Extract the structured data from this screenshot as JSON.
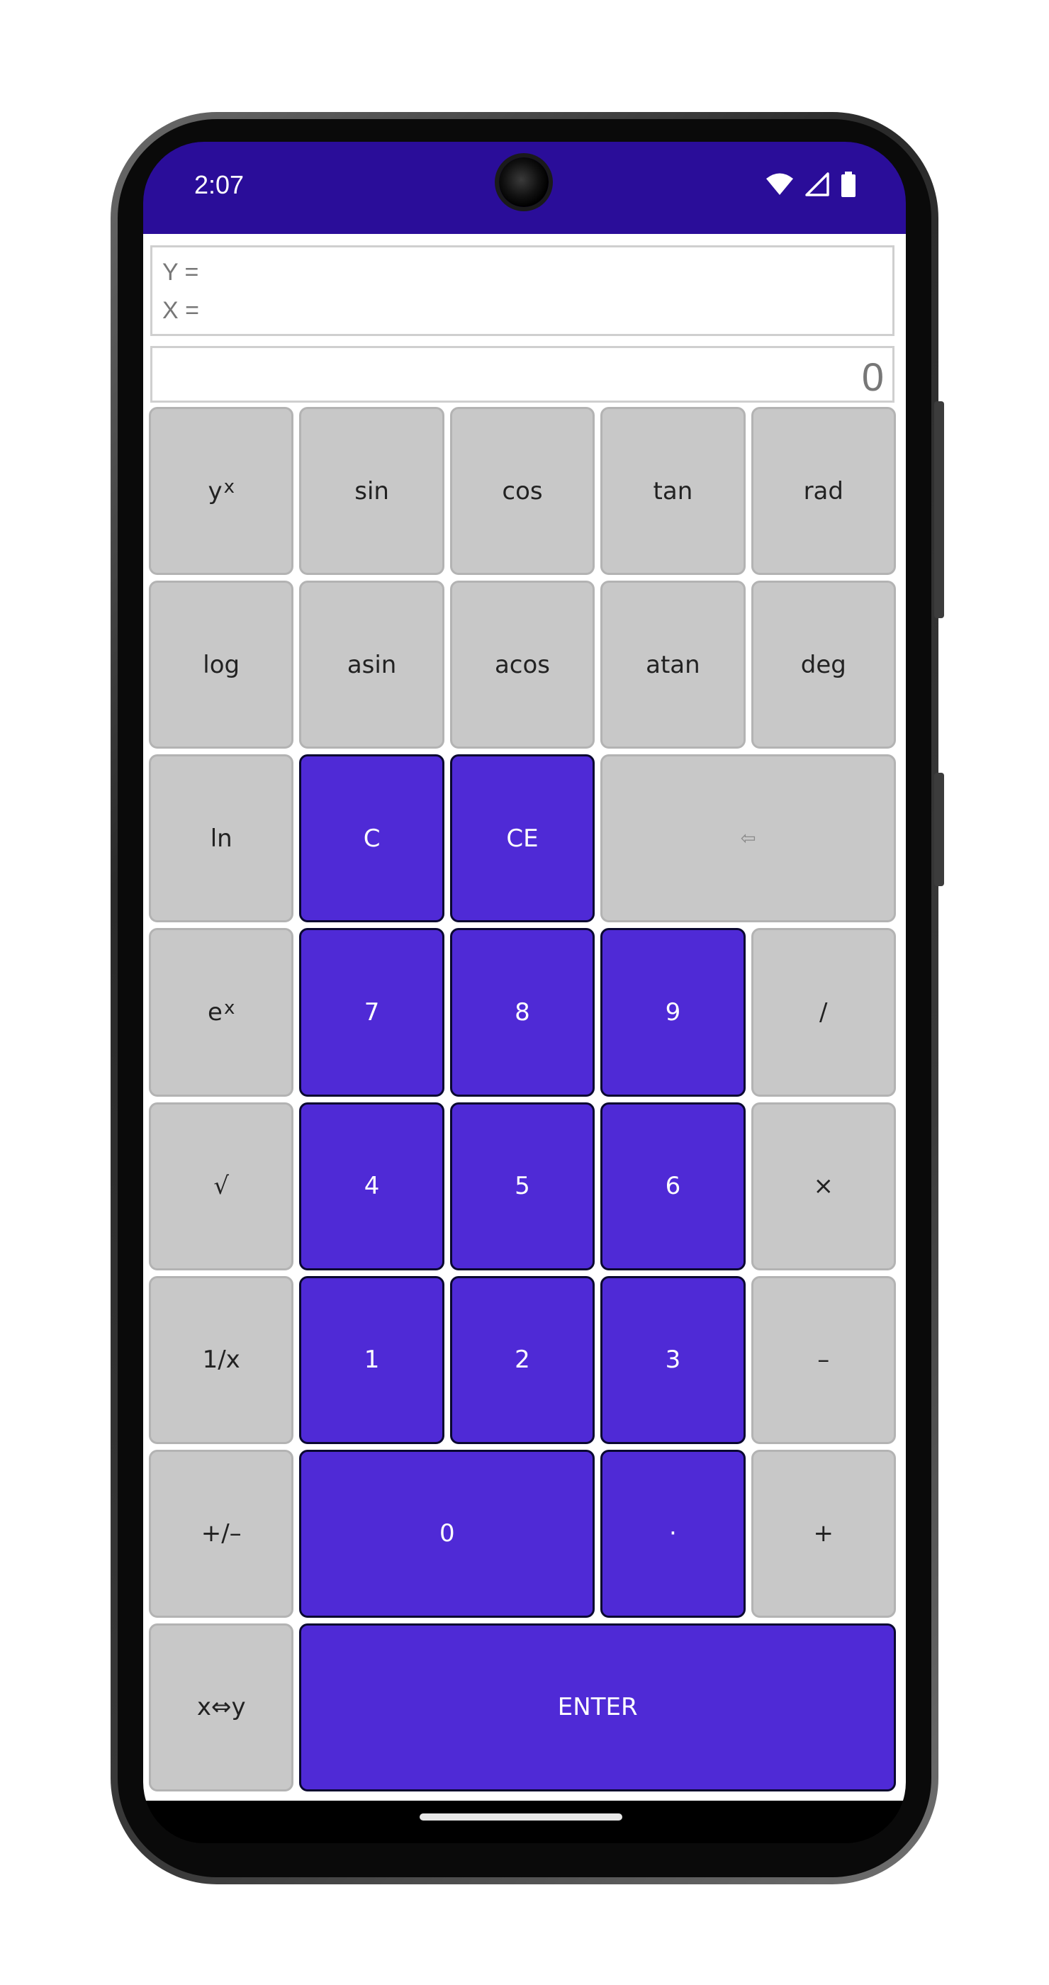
{
  "status_bar": {
    "time": "2:07",
    "background_color": "#2a0d99",
    "icons": [
      "wifi-icon",
      "cellular-signal-icon",
      "battery-icon"
    ]
  },
  "display": {
    "stack_y_label": "Y =",
    "stack_x_label": "X =",
    "main_value": "0"
  },
  "colors": {
    "digit_key": "#4f2ad6",
    "function_key": "#c8c8c8"
  },
  "keys": {
    "pow": {
      "base": "y",
      "exp": "x"
    },
    "sin": "sin",
    "cos": "cos",
    "tan": "tan",
    "rad": "rad",
    "log": "log",
    "asin": "asin",
    "acos": "acos",
    "atan": "atan",
    "deg": "deg",
    "ln": "ln",
    "clear": "C",
    "clear_entry": "CE",
    "backspace": "⇦",
    "exp": {
      "base": "e",
      "exp": "x"
    },
    "seven": "7",
    "eight": "8",
    "nine": "9",
    "divide": "/",
    "sqrt": "√",
    "four": "4",
    "five": "5",
    "six": "6",
    "multiply": "×",
    "reciprocal": "1/x",
    "one": "1",
    "two": "2",
    "three": "3",
    "minus": "–",
    "negate": "+/–",
    "zero": "0",
    "decimal": "·",
    "plus": "+",
    "swap": "x⇔y",
    "enter": "ENTER"
  }
}
